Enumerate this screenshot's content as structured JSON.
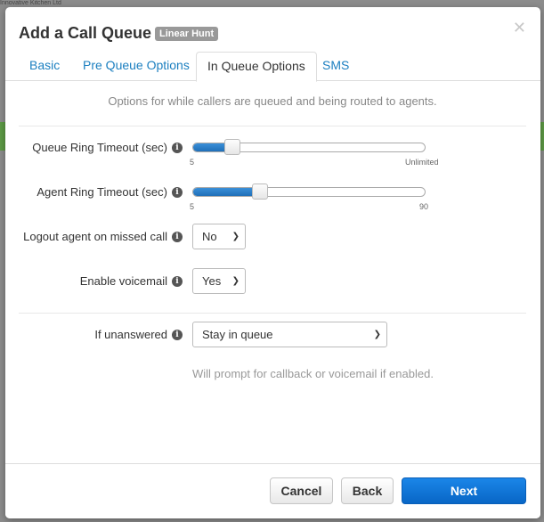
{
  "background": {
    "app_text": "Innovative Kitchen Ltd"
  },
  "modal": {
    "title": "Add a Call Queue",
    "badge": "Linear Hunt",
    "close_icon": "close-icon"
  },
  "tabs": [
    {
      "label": "Basic",
      "active": false
    },
    {
      "label": "Pre Queue Options",
      "active": false
    },
    {
      "label": "In Queue Options",
      "active": true
    },
    {
      "label": "SMS",
      "active": false
    }
  ],
  "intro_text": "Options for while callers are queued and being routed to agents.",
  "fields": {
    "queue_ring_timeout": {
      "label": "Queue Ring Timeout (sec)",
      "min_label": "5",
      "max_label": "Unlimited",
      "position_fraction": 0.17
    },
    "agent_ring_timeout": {
      "label": "Agent Ring Timeout (sec)",
      "min_label": "5",
      "max_label": "90",
      "position_fraction": 0.29
    },
    "logout_on_missed": {
      "label": "Logout agent on missed call",
      "value": "No"
    },
    "enable_voicemail": {
      "label": "Enable voicemail",
      "value": "Yes"
    },
    "if_unanswered": {
      "label": "If unanswered",
      "value": "Stay in queue",
      "help": "Will prompt for callback or voicemail if enabled."
    }
  },
  "buttons": {
    "cancel": "Cancel",
    "back": "Back",
    "next": "Next"
  },
  "colors": {
    "primary": "#0a6fd1",
    "link": "#1b7fc0",
    "badge": "#999999"
  }
}
